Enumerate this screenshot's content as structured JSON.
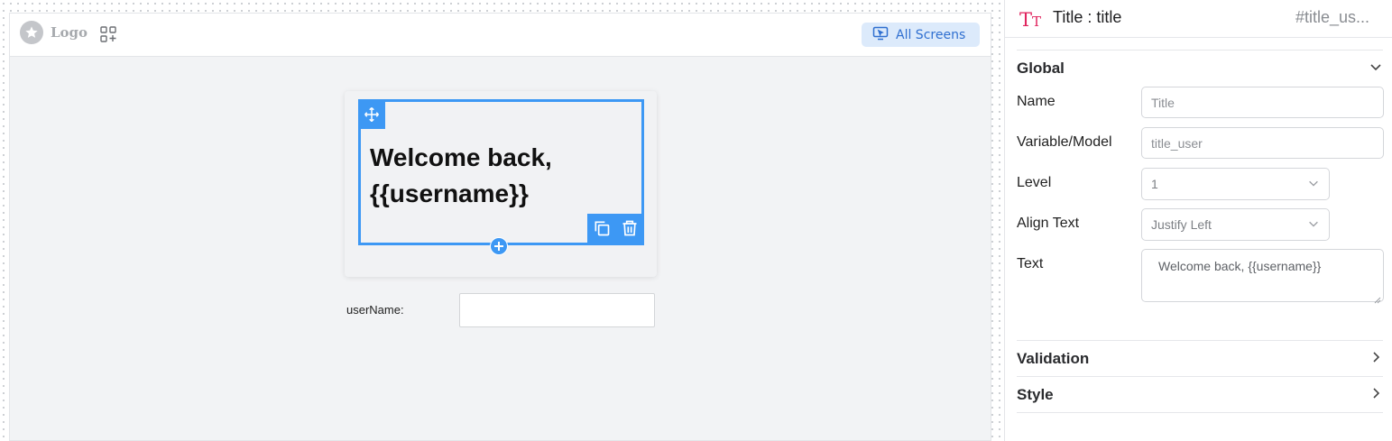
{
  "topbar": {
    "logo_text": "Logo",
    "all_screens_label": "All Screens"
  },
  "canvas": {
    "title_text": "Welcome back, {{username}}",
    "field_label": "userName:",
    "field_value": ""
  },
  "panel": {
    "title": "Title : title",
    "id": "#title_us...",
    "global": {
      "heading": "Global",
      "name_label": "Name",
      "name_placeholder": "Title",
      "variable_label": "Variable/Model",
      "variable_placeholder": "title_user",
      "level_label": "Level",
      "level_value": "1",
      "align_label": "Align Text",
      "align_value": "Justify Left",
      "text_label": "Text",
      "text_value": "Welcome back, {{username}}"
    },
    "validation_heading": "Validation",
    "style_heading": "Style"
  },
  "colors": {
    "selection": "#3d98f4",
    "accent_text": "#2f6fd0",
    "title_icon": "#e0245e"
  },
  "icons": [
    "star-icon",
    "apps-add-icon",
    "screen-cursor-icon",
    "move-icon",
    "copy-icon",
    "trash-icon",
    "plus-icon",
    "text-type-icon",
    "chevron-down-icon",
    "chevron-right-icon"
  ]
}
